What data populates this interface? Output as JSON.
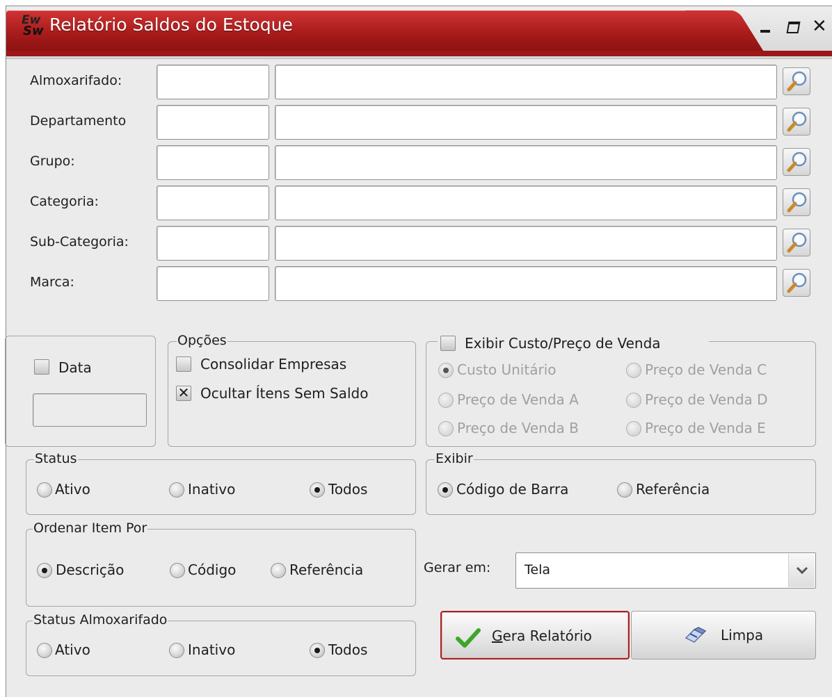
{
  "window": {
    "title": "Relatório Saldos do Estoque",
    "app_icon_text_top": "Ew",
    "app_icon_text_bottom": "Sw"
  },
  "filters": [
    {
      "label": "Almoxarifado:",
      "code": "",
      "description": ""
    },
    {
      "label": "Departamento",
      "code": "",
      "description": ""
    },
    {
      "label": "Grupo:",
      "code": "",
      "description": ""
    },
    {
      "label": "Categoria:",
      "code": "",
      "description": ""
    },
    {
      "label": "Sub-Categoria:",
      "code": "",
      "description": ""
    },
    {
      "label": "Marca:",
      "code": "",
      "description": ""
    }
  ],
  "data_group": {
    "checkbox_label": "Data",
    "checked": false,
    "date_value": ""
  },
  "opcoes": {
    "title": "Opções",
    "consolidar_label": "Consolidar Empresas",
    "consolidar_checked": false,
    "ocultar_label": "Ocultar Ítens Sem Saldo",
    "ocultar_checked": true,
    "check_mark": "✕"
  },
  "exibir_custo": {
    "title": "Exibir Custo/Preço de Venda",
    "checked": false,
    "options": {
      "custo_unitario": "Custo Unitário",
      "preco_a": "Preço de Venda A",
      "preco_b": "Preço de Venda B",
      "preco_c": "Preço de Venda C",
      "preco_d": "Preço de Venda D",
      "preco_e": "Preço de Venda E"
    },
    "selected": "Custo Unitário"
  },
  "status": {
    "title": "Status",
    "ativo": "Ativo",
    "inativo": "Inativo",
    "todos": "Todos",
    "selected": "Todos"
  },
  "exibir": {
    "title": "Exibir",
    "codigo_barra": "Código de Barra",
    "referencia": "Referência",
    "selected": "Código de Barra"
  },
  "ordenar": {
    "title": "Ordenar Item Por",
    "descricao": "Descrição",
    "codigo": "Código",
    "referencia": "Referência",
    "selected": "Descrição"
  },
  "gerar_em": {
    "label": "Gerar em:",
    "value": "Tela"
  },
  "status_almox": {
    "title": "Status Almoxarifado",
    "ativo": "Ativo",
    "inativo": "Inativo",
    "todos": "Todos",
    "selected": "Todos"
  },
  "buttons": {
    "gera_relatorio_mnemonic": "G",
    "gera_relatorio_rest": "era Relatório",
    "limpa": "Limpa"
  },
  "colors": {
    "title_red": "#a91c1c",
    "check_green": "#3fa52a",
    "window_bg": "#ebebeb"
  }
}
